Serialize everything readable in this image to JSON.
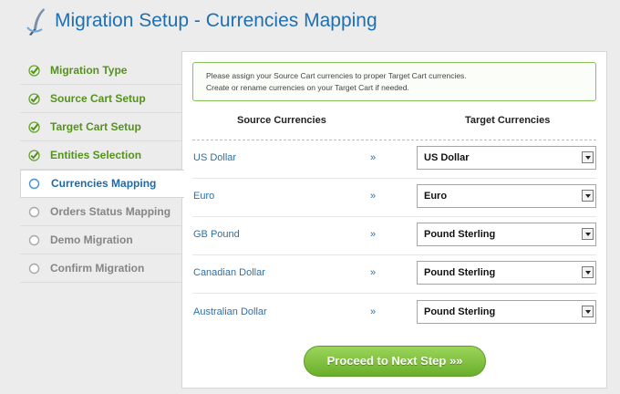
{
  "header": {
    "title": "Migration Setup - Currencies Mapping",
    "logo_icon": "feather-logo-icon"
  },
  "sidebar": {
    "steps": [
      {
        "label": "Migration Type",
        "state": "done"
      },
      {
        "label": "Source Cart Setup",
        "state": "done"
      },
      {
        "label": "Target Cart Setup",
        "state": "done"
      },
      {
        "label": "Entities Selection",
        "state": "done"
      },
      {
        "label": "Currencies Mapping",
        "state": "active"
      },
      {
        "label": "Orders Status Mapping",
        "state": "pending"
      },
      {
        "label": "Demo Migration",
        "state": "pending"
      },
      {
        "label": "Confirm Migration",
        "state": "pending"
      }
    ]
  },
  "main": {
    "notice": {
      "line1": "Please assign your Source Cart currencies to proper Target Cart currencies.",
      "line2": "Create or rename currencies on your Target Cart if needed."
    },
    "columns": {
      "source": "Source Currencies",
      "target": "Target Currencies"
    },
    "arrow": "»",
    "mappings": [
      {
        "source": "US Dollar",
        "target": "US Dollar"
      },
      {
        "source": "Euro",
        "target": "Euro"
      },
      {
        "source": "GB Pound",
        "target": "Pound Sterling"
      },
      {
        "source": "Canadian Dollar",
        "target": "Pound Sterling"
      },
      {
        "source": "Australian Dollar",
        "target": "Pound Sterling"
      }
    ],
    "proceed_label": "Proceed to Next Step »»"
  },
  "colors": {
    "title": "#1f6fb3",
    "done": "#55921d",
    "active": "#1e6aa8",
    "pending": "#858585",
    "button": "#7bbf3a"
  }
}
